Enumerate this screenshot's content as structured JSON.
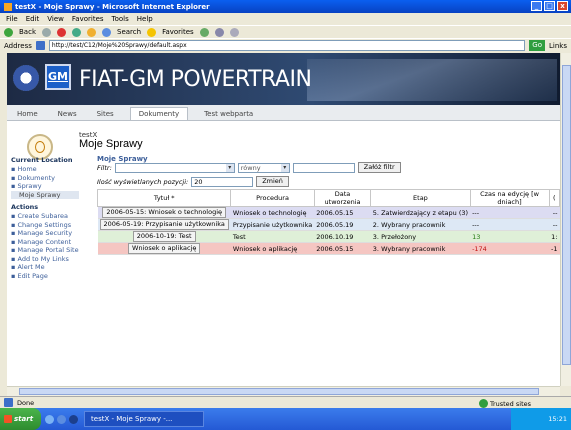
{
  "window": {
    "title": "testX - Moje Sprawy - Microsoft Internet Explorer",
    "min": "_",
    "max": "□",
    "close": "x"
  },
  "menu": [
    "File",
    "Edit",
    "View",
    "Favorites",
    "Tools",
    "Help"
  ],
  "toolbar": {
    "back": "Back",
    "search": "Search",
    "favorites": "Favorites"
  },
  "address": {
    "label": "Address",
    "url": "http://test/C12/Moje%20Sprawy/default.aspx",
    "go": "Go",
    "links": "Links"
  },
  "banner": {
    "logo_gm": "GM",
    "title": "FIAT-GM POWERTRAIN"
  },
  "nav": {
    "tabs": [
      "Home",
      "News",
      "Sites",
      "Dokumenty",
      "Test webparta"
    ],
    "active_index": 3
  },
  "site": {
    "subtitle": "testX",
    "title": "Moje Sprawy"
  },
  "leftnav": {
    "current_location_header": "Current Location",
    "location_items": [
      "Home",
      "Dokumenty",
      "Sprawy"
    ],
    "location_selected": "Moje Sprawy",
    "actions_header": "Actions",
    "actions": [
      "Create Subarea",
      "Change Settings",
      "Manage Security",
      "Manage Content",
      "Manage Portal Site",
      "Add to My Links",
      "Alert Me",
      "Edit Page"
    ]
  },
  "list": {
    "title": "Moje Sprawy",
    "filter_label": "Filtr:",
    "filter_operator": "równy",
    "filter_button": "Załóż filtr",
    "count_label": "Ilość wyświetlanych pozycji:",
    "count_value": "20",
    "count_button": "Zmień",
    "columns": [
      "Tytuł *",
      "Procedura",
      "Data utworzenia",
      "Etap",
      "Czas na edycję [w dniach]",
      "("
    ],
    "rows": [
      {
        "title": "2006-05-15: Wniosek o technologię",
        "procedure": "Wniosek o technologię",
        "date": "2006.05.15",
        "stage": "5. Zatwierdzający z etapu (3)",
        "days": "---",
        "extra": "--",
        "style": "r-purple",
        "days_color": ""
      },
      {
        "title": "2006-05-19: Przypisanie użytkownika",
        "procedure": "Przypisanie użytkownika",
        "date": "2006.05.19",
        "stage": "2. Wybrany pracownik",
        "days": "---",
        "extra": "--",
        "style": "r-blue",
        "days_color": ""
      },
      {
        "title": "2006-10-19: Test",
        "procedure": "Test",
        "date": "2006.10.19",
        "stage": "3. Przełożony",
        "days": "13",
        "extra": "1:",
        "style": "r-green",
        "days_color": "green"
      },
      {
        "title": "Wniosek o aplikację",
        "procedure": "Wniosek o aplikację",
        "date": "2006.05.15",
        "stage": "3. Wybrany pracownik",
        "days": "-174",
        "extra": "-1",
        "style": "r-red",
        "days_color": "red"
      }
    ]
  },
  "status": {
    "left": "Done",
    "zone": "Trusted sites"
  },
  "taskbar": {
    "start": "start",
    "task": "testX - Moje Sprawy -...",
    "time": "15:21"
  }
}
